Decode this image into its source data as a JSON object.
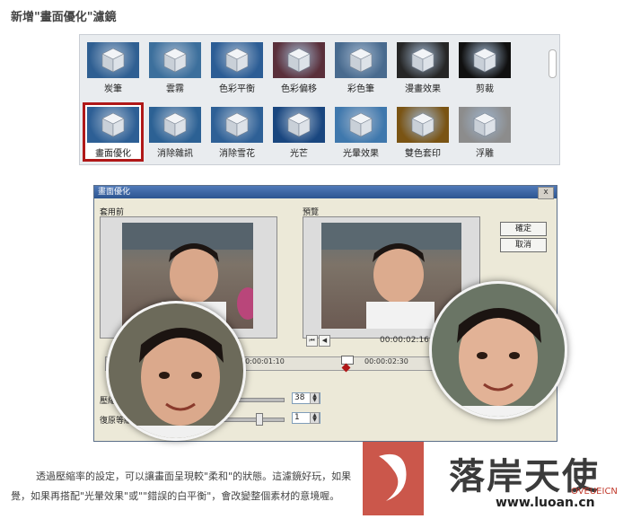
{
  "heading": "新增\"畫面優化\"濾鏡",
  "gallery": {
    "items": [
      {
        "label": "炭筆",
        "tone": "#2f5f92"
      },
      {
        "label": "雲霧",
        "tone": "#3c6f9c"
      },
      {
        "label": "色彩平衡",
        "tone": "#2c5d95"
      },
      {
        "label": "色彩偏移",
        "tone": "#5a2f3a"
      },
      {
        "label": "彩色筆",
        "tone": "#486a8e"
      },
      {
        "label": "漫畫效果",
        "tone": "#262626"
      },
      {
        "label": "剪裁",
        "tone": "#101010"
      },
      {
        "label": "畫面優化",
        "tone": "#2d5f95",
        "selected": true
      },
      {
        "label": "消除雜訊",
        "tone": "#2c6194"
      },
      {
        "label": "消除雪花",
        "tone": "#2e6096"
      },
      {
        "label": "光芒",
        "tone": "#19467f"
      },
      {
        "label": "光暈效果",
        "tone": "#3f78ad"
      },
      {
        "label": "雙色套印",
        "tone": "#7a5414"
      },
      {
        "label": "浮雕",
        "tone": "#8c8c8c"
      }
    ]
  },
  "dialog": {
    "title": "畫面優化",
    "close": "x",
    "before_label": "套用前",
    "preview_label": "預覽",
    "ok": "確定",
    "cancel": "取消",
    "time_preview": "00:00:02:16",
    "time_tick1": "00:00:01:10",
    "time_tick2": "00:00:02:30",
    "ctrl1_label": "壓縮等",
    "ctrl1_value": "38",
    "ctrl2_label": "復原等級",
    "ctrl2_value": "1"
  },
  "paragraph": {
    "line1": "透過壓縮率的設定，可以讓畫面呈現較\"柔和\"的狀態。這濾鏡好玩，如果",
    "line2": "覺，如果再搭配\"光暈效果\"或\"\"錯誤的白平衡\"，會改變整個素材的意境喔。"
  },
  "watermark": {
    "brand": "落",
    "brand_rest": "岸天使",
    "url": "www.luoan.cn",
    "small": "OVEUEICN"
  }
}
